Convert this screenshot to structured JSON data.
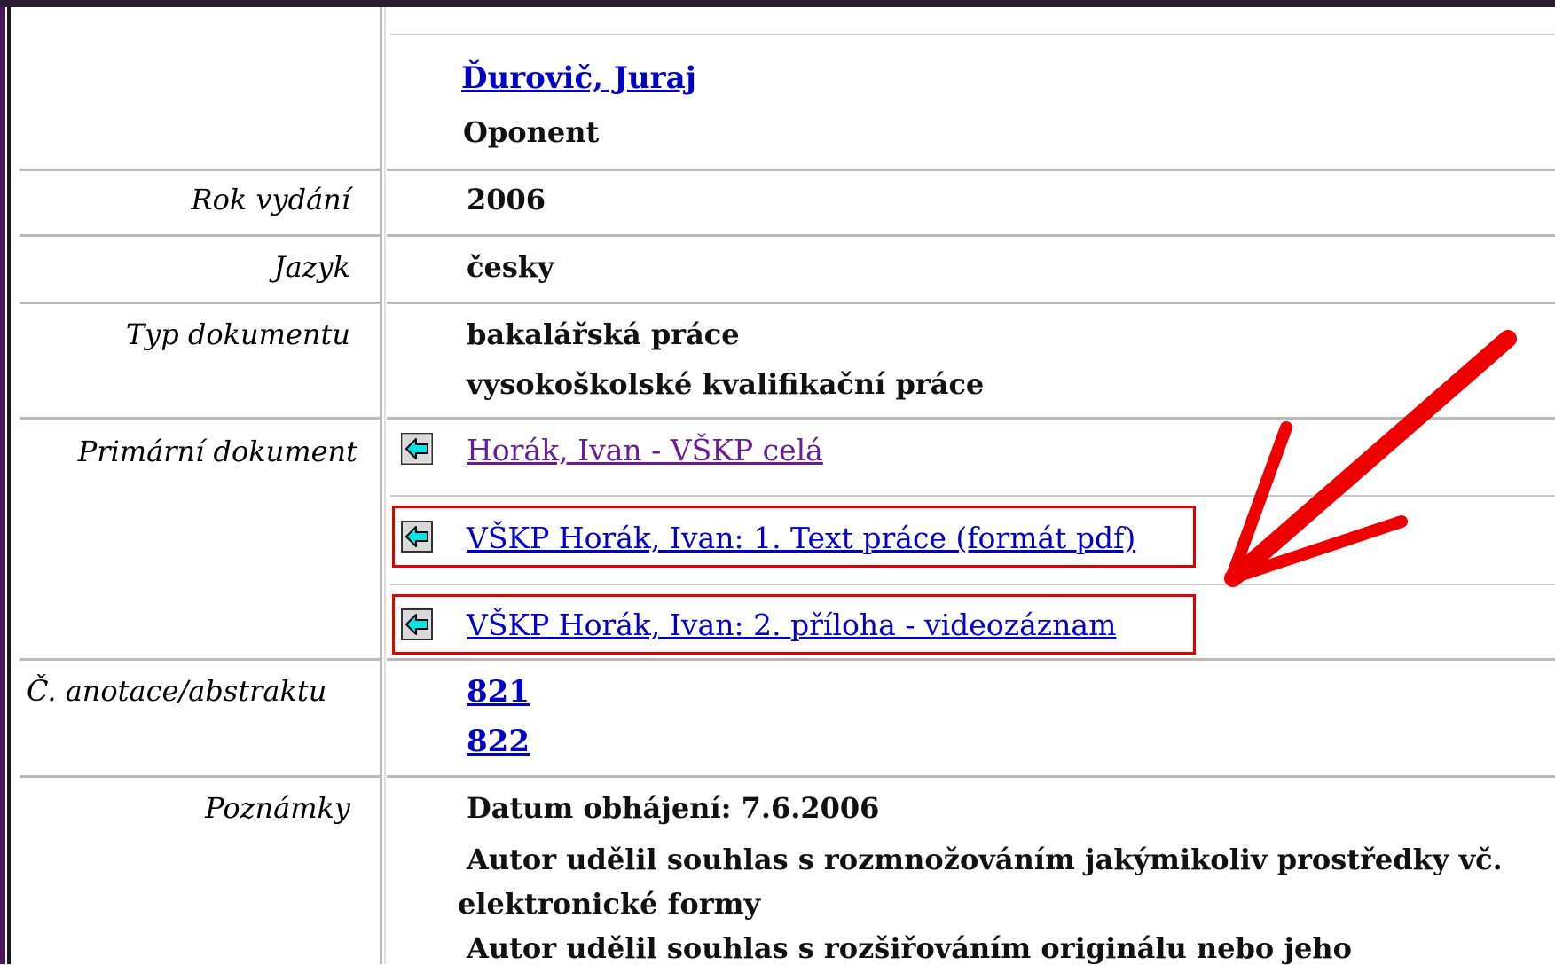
{
  "record": {
    "author_link": "Ďurovič, Juraj",
    "author_role": "Oponent",
    "fields": {
      "year": {
        "label": "Rok vydání",
        "value": "2006"
      },
      "language": {
        "label": "Jazyk",
        "value": "česky"
      },
      "doc_type": {
        "label": "Typ dokumentu",
        "value_1": "bakalářská práce",
        "value_2": "vysokoškolské kvalifikační práce"
      },
      "primary_doc": {
        "label": "Primární dokument",
        "links": [
          "Horák, Ivan - VŠKP celá",
          "VŠKP Horák, Ivan: 1. Text práce (formát pdf)",
          "VŠKP Horák, Ivan: 2. příloha - videozáznam"
        ]
      },
      "annotation": {
        "label": "Č. anotace/abstraktu",
        "values": [
          "821",
          "822"
        ]
      },
      "notes": {
        "label": "Poznámky",
        "lines": [
          "Datum obhájení: 7.6.2006",
          "Autor udělil souhlas s rozmnožováním jakýmikoliv prostředky vč.",
          "elektronické formy",
          "Autor udělil souhlas s rozšiřováním originálu nebo jeho"
        ]
      }
    }
  },
  "icons": {
    "doc_arrow": "cyan-left-arrow-icon"
  },
  "colors": {
    "highlight": "#e00000",
    "link": "#0000cc",
    "visited": "#6a1b9a",
    "icon_fill": "#00e5e5"
  }
}
